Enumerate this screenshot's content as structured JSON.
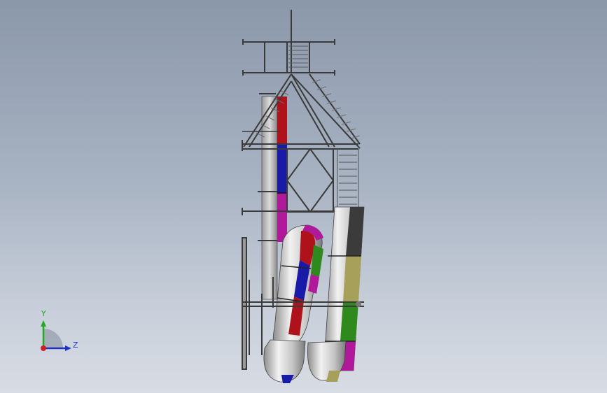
{
  "triad": {
    "y_label": "Y",
    "z_label": "Z",
    "colors": {
      "y": "#22aa22",
      "z": "#2233cc",
      "x": "#cc2222"
    }
  },
  "model": {
    "icon": "water-slide-tower-3d-model",
    "palette": {
      "steel": "#3a3a3a",
      "pipe_light": "#e6e6e6",
      "pipe_shade": "#9a9a9a",
      "red": "#b0121b",
      "blue": "#1a1aa8",
      "magenta": "#b0199a",
      "green": "#2f8a1e",
      "olive": "#a6a05a",
      "gray_band": "#3b3b3b"
    }
  }
}
